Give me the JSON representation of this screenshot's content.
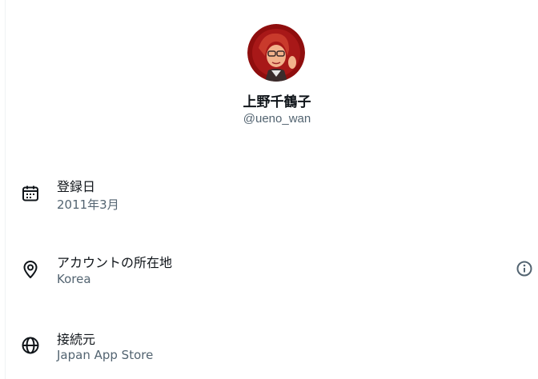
{
  "profile": {
    "display_name": "上野千鶴子",
    "handle": "@ueno_wan",
    "avatar": "bitmoji-avatar"
  },
  "rows": [
    {
      "icon": "calendar-icon",
      "title": "登録日",
      "subtitle": "2011年3月"
    },
    {
      "icon": "location-pin-icon",
      "title": "アカウントの所在地",
      "subtitle": "Korea",
      "action_icon": "info-icon"
    },
    {
      "icon": "globe-icon",
      "title": "接続元",
      "subtitle": "Japan App Store"
    }
  ],
  "colors": {
    "text_primary": "#0f1419",
    "text_secondary": "#536471",
    "avatar_bg": "#a11414"
  }
}
